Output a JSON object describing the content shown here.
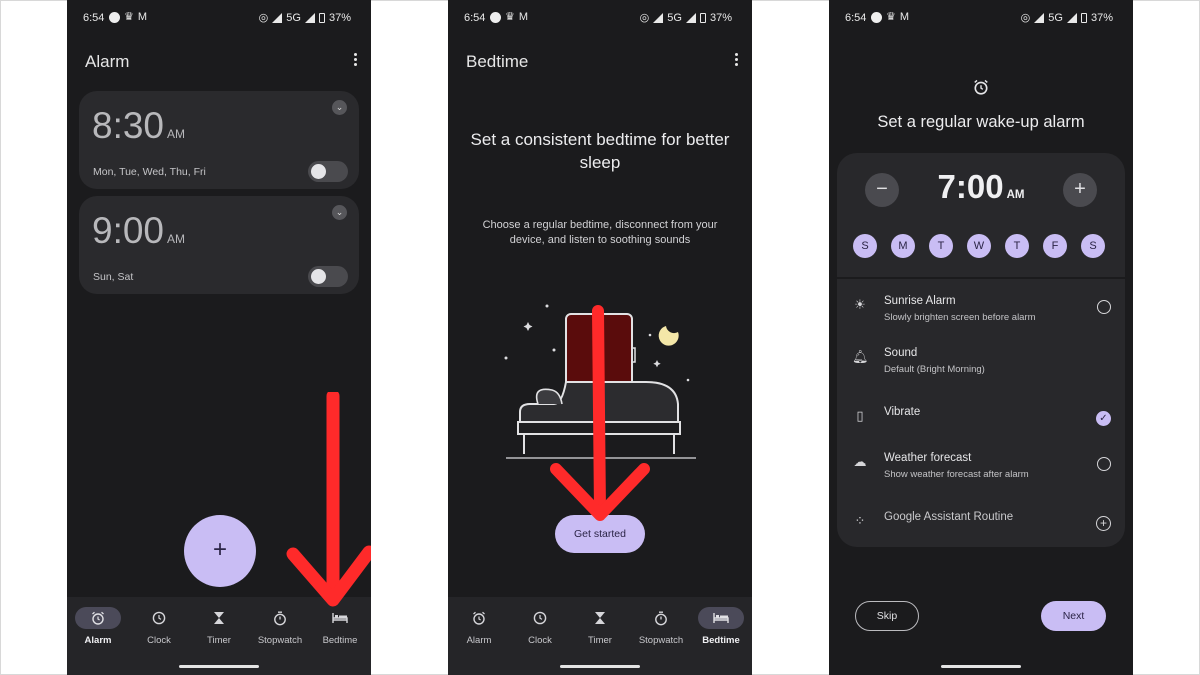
{
  "status_bar": {
    "time": "6:54",
    "network": "5G",
    "battery": "37%"
  },
  "screen_alarm": {
    "title": "Alarm",
    "alarms": [
      {
        "time": "8:30",
        "meridiem": "AM",
        "days": "Mon, Tue, Wed, Thu, Fri",
        "enabled": false
      },
      {
        "time": "9:00",
        "meridiem": "AM",
        "days": "Sun, Sat",
        "enabled": false
      }
    ],
    "fab_label": "+"
  },
  "screen_bedtime": {
    "title": "Bedtime",
    "headline": "Set a consistent bedtime for better sleep",
    "subtext": "Choose a regular bedtime, disconnect from your device, and listen to soothing sounds",
    "cta": "Get started"
  },
  "screen_wakeup": {
    "title": "Set a regular wake-up alarm",
    "time": "7:00",
    "meridiem": "AM",
    "minus": "−",
    "plus": "+",
    "days": [
      "S",
      "M",
      "T",
      "W",
      "T",
      "F",
      "S"
    ],
    "options": [
      {
        "title": "Sunrise Alarm",
        "subtitle": "Slowly brighten screen before alarm",
        "control": "radio"
      },
      {
        "title": "Sound",
        "subtitle": "Default (Bright Morning)",
        "control": "none"
      },
      {
        "title": "Vibrate",
        "subtitle": "",
        "control": "checked"
      },
      {
        "title": "Weather forecast",
        "subtitle": "Show weather forecast after alarm",
        "control": "radio"
      },
      {
        "title": "Google Assistant Routine",
        "subtitle": "",
        "control": "add"
      }
    ],
    "skip": "Skip",
    "next": "Next"
  },
  "nav": {
    "items": [
      "Alarm",
      "Clock",
      "Timer",
      "Stopwatch",
      "Bedtime"
    ]
  },
  "colors": {
    "accent": "#c9bdf4",
    "background": "#1b1b1d",
    "annotation_arrow": "#ff2a2a"
  }
}
